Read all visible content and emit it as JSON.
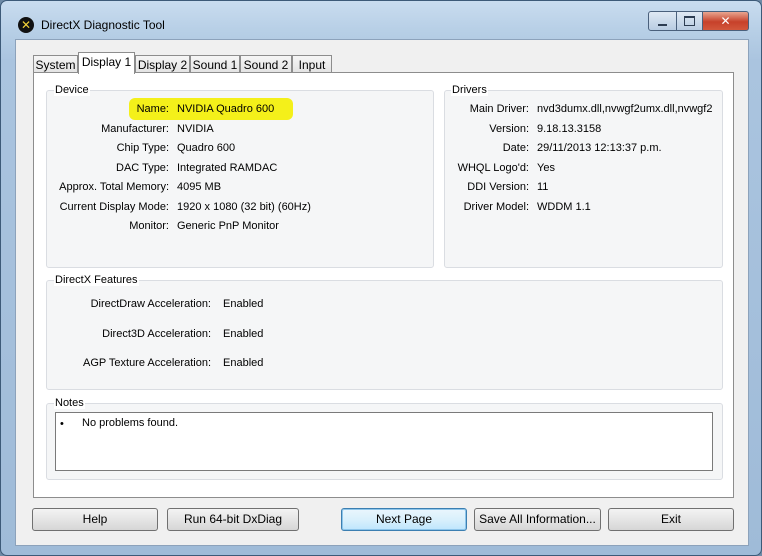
{
  "window": {
    "title": "DirectX Diagnostic Tool",
    "close_glyph": "✕"
  },
  "tabs": [
    {
      "label": "System"
    },
    {
      "label": "Display 1"
    },
    {
      "label": "Display 2"
    },
    {
      "label": "Sound 1"
    },
    {
      "label": "Sound 2"
    },
    {
      "label": "Input"
    }
  ],
  "device": {
    "heading": "Device",
    "rows": [
      {
        "label": "Name:",
        "value": "NVIDIA Quadro 600"
      },
      {
        "label": "Manufacturer:",
        "value": "NVIDIA"
      },
      {
        "label": "Chip Type:",
        "value": "Quadro 600"
      },
      {
        "label": "DAC Type:",
        "value": "Integrated RAMDAC"
      },
      {
        "label": "Approx. Total Memory:",
        "value": "4095 MB"
      },
      {
        "label": "Current Display Mode:",
        "value": "1920 x 1080 (32 bit) (60Hz)"
      },
      {
        "label": "Monitor:",
        "value": "Generic PnP Monitor"
      }
    ]
  },
  "drivers": {
    "heading": "Drivers",
    "rows": [
      {
        "label": "Main Driver:",
        "value": "nvd3dumx.dll,nvwgf2umx.dll,nvwgf2"
      },
      {
        "label": "Version:",
        "value": "9.18.13.3158"
      },
      {
        "label": "Date:",
        "value": "29/11/2013 12:13:37 p.m."
      },
      {
        "label": "WHQL Logo'd:",
        "value": "Yes"
      },
      {
        "label": "DDI Version:",
        "value": "11"
      },
      {
        "label": "Driver Model:",
        "value": "WDDM 1.1"
      }
    ]
  },
  "features": {
    "heading": "DirectX Features",
    "rows": [
      {
        "label": "DirectDraw Acceleration:",
        "value": "Enabled"
      },
      {
        "label": "Direct3D Acceleration:",
        "value": "Enabled"
      },
      {
        "label": "AGP Texture Acceleration:",
        "value": "Enabled"
      }
    ]
  },
  "notes": {
    "heading": "Notes",
    "bullet": "•",
    "items": [
      "No problems found."
    ]
  },
  "buttons": {
    "help": "Help",
    "run64": "Run 64-bit DxDiag",
    "next": "Next Page",
    "save": "Save All Information...",
    "exit": "Exit"
  },
  "highlight_color": "#f4f01a"
}
